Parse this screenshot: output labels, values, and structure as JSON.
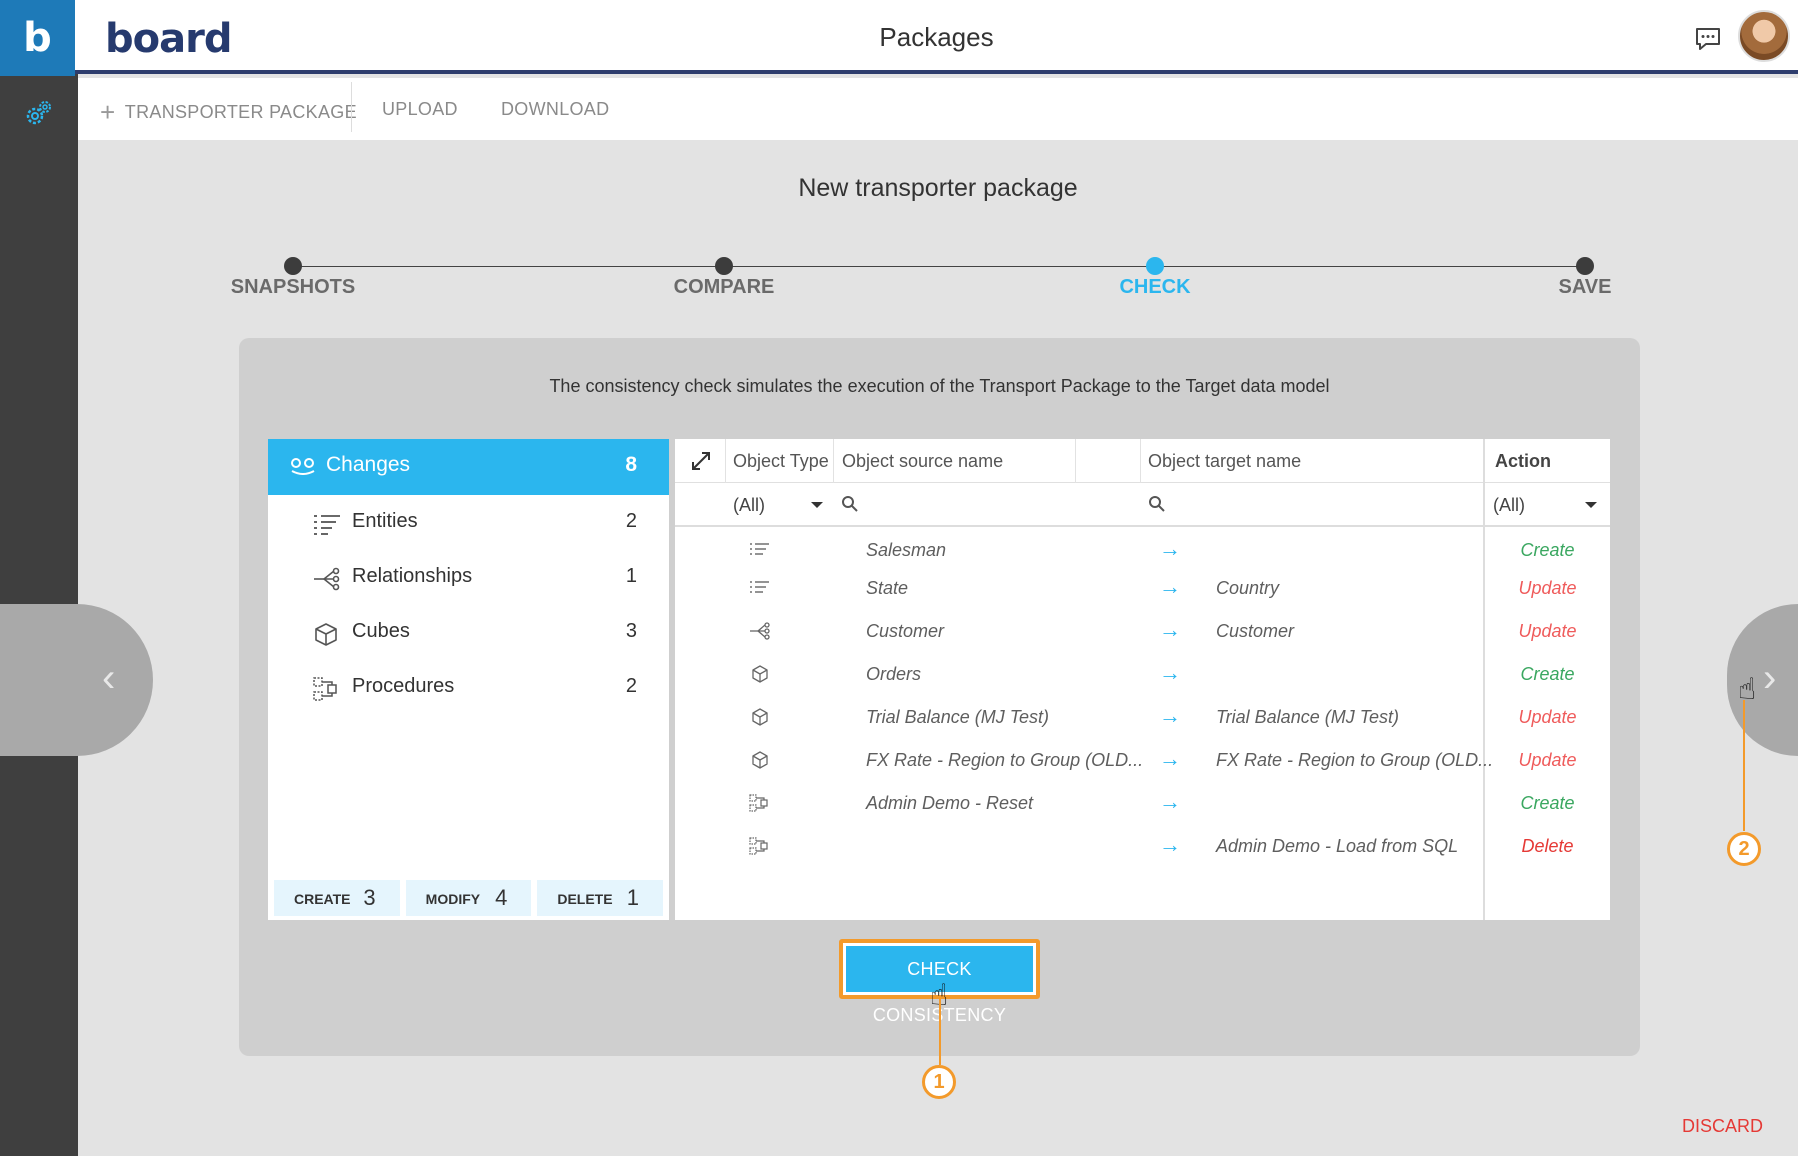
{
  "rail": {
    "logo_letter": "b"
  },
  "header": {
    "brand_main": "board",
    "title": "Packages"
  },
  "toolbar": {
    "new_package": "TRANSPORTER PACKAGE",
    "upload": "UPLOAD",
    "download": "DOWNLOAD"
  },
  "wizard": {
    "title": "New transporter package",
    "steps": [
      "SNAPSHOTS",
      "COMPARE",
      "CHECK",
      "SAVE"
    ],
    "active_step": "CHECK"
  },
  "card": {
    "description": "The consistency check simulates the execution of the Transport Package to the Target data model"
  },
  "changes": {
    "header": {
      "label": "Changes",
      "count": "8"
    },
    "items": [
      {
        "label": "Entities",
        "count": "2",
        "icon": "entities-icon"
      },
      {
        "label": "Relationships",
        "count": "1",
        "icon": "relationships-icon"
      },
      {
        "label": "Cubes",
        "count": "3",
        "icon": "cube-icon"
      },
      {
        "label": "Procedures",
        "count": "2",
        "icon": "procedure-icon"
      }
    ],
    "stats": [
      {
        "label": "CREATE",
        "value": "3"
      },
      {
        "label": "MODIFY",
        "value": "4"
      },
      {
        "label": "DELETE",
        "value": "1"
      }
    ]
  },
  "table": {
    "columns": {
      "object_type": "Object Type",
      "source": "Object source name",
      "target": "Object target name",
      "action": "Action"
    },
    "filters": {
      "object_type": "(All)",
      "action": "(All)"
    },
    "arrow": "→",
    "rows": [
      {
        "type": "entity",
        "source": "Salesman",
        "target": "",
        "action": "Create"
      },
      {
        "type": "entity",
        "source": "State",
        "target": "Country",
        "action": "Update"
      },
      {
        "type": "relationship",
        "source": "Customer",
        "target": "Customer",
        "action": "Update"
      },
      {
        "type": "cube",
        "source": "Orders",
        "target": "",
        "action": "Create"
      },
      {
        "type": "cube",
        "source": "Trial Balance (MJ Test)",
        "target": "Trial Balance (MJ Test)",
        "action": "Update"
      },
      {
        "type": "cube",
        "source": "FX Rate - Region to Group (OLD...",
        "target": "FX Rate - Region to Group (OLD...",
        "action": "Update"
      },
      {
        "type": "procedure",
        "source": "Admin Demo - Reset",
        "target": "",
        "action": "Create"
      },
      {
        "type": "procedure",
        "source": "",
        "target": "Admin Demo - Load from SQL",
        "action": "Delete"
      }
    ]
  },
  "buttons": {
    "check": "CHECK CONSISTENCY",
    "discard": "DISCARD"
  },
  "callouts": [
    "1",
    "2"
  ],
  "colors": {
    "accent": "#2bb6ee",
    "callout": "#f39a2b",
    "create": "#3aa760",
    "update": "#ef5b5b",
    "delete": "#e53935"
  }
}
